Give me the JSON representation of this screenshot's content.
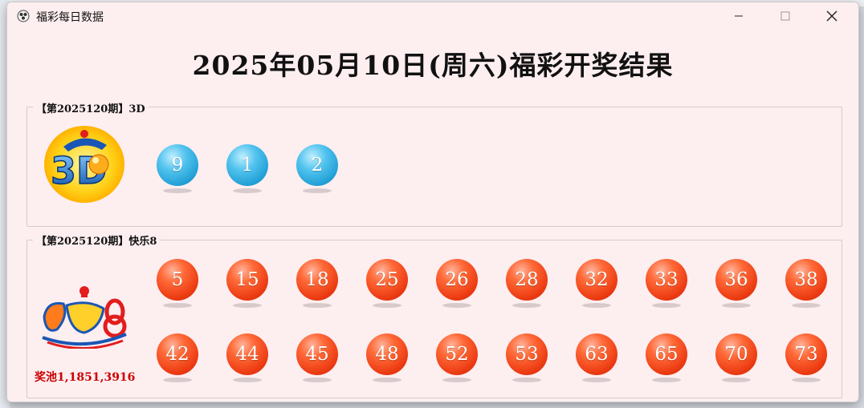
{
  "window": {
    "title": "福彩每日数据",
    "controls": {
      "minimize": "minimize",
      "maximize": "maximize",
      "close": "close"
    }
  },
  "heading": "2025年05月10日(周六)福彩开奖结果",
  "lottery_3d": {
    "group_label": "【第2025120期】3D",
    "logo": "3d-logo",
    "balls": [
      "9",
      "1",
      "2"
    ]
  },
  "lottery_k8": {
    "group_label": "【第2025120期】快乐8",
    "logo": "kuaile8-logo",
    "balls_row1": [
      "5",
      "15",
      "18",
      "25",
      "26",
      "28",
      "32",
      "33",
      "36",
      "38"
    ],
    "balls_row2": [
      "42",
      "44",
      "45",
      "48",
      "52",
      "53",
      "63",
      "65",
      "70",
      "73"
    ],
    "prize_pool": "奖池1,1851,3916"
  },
  "colors": {
    "window_bg": "#fdeef0",
    "ball_blue": "#29a9dd",
    "ball_red": "#ea3c14",
    "prize_text": "#cc0000"
  }
}
